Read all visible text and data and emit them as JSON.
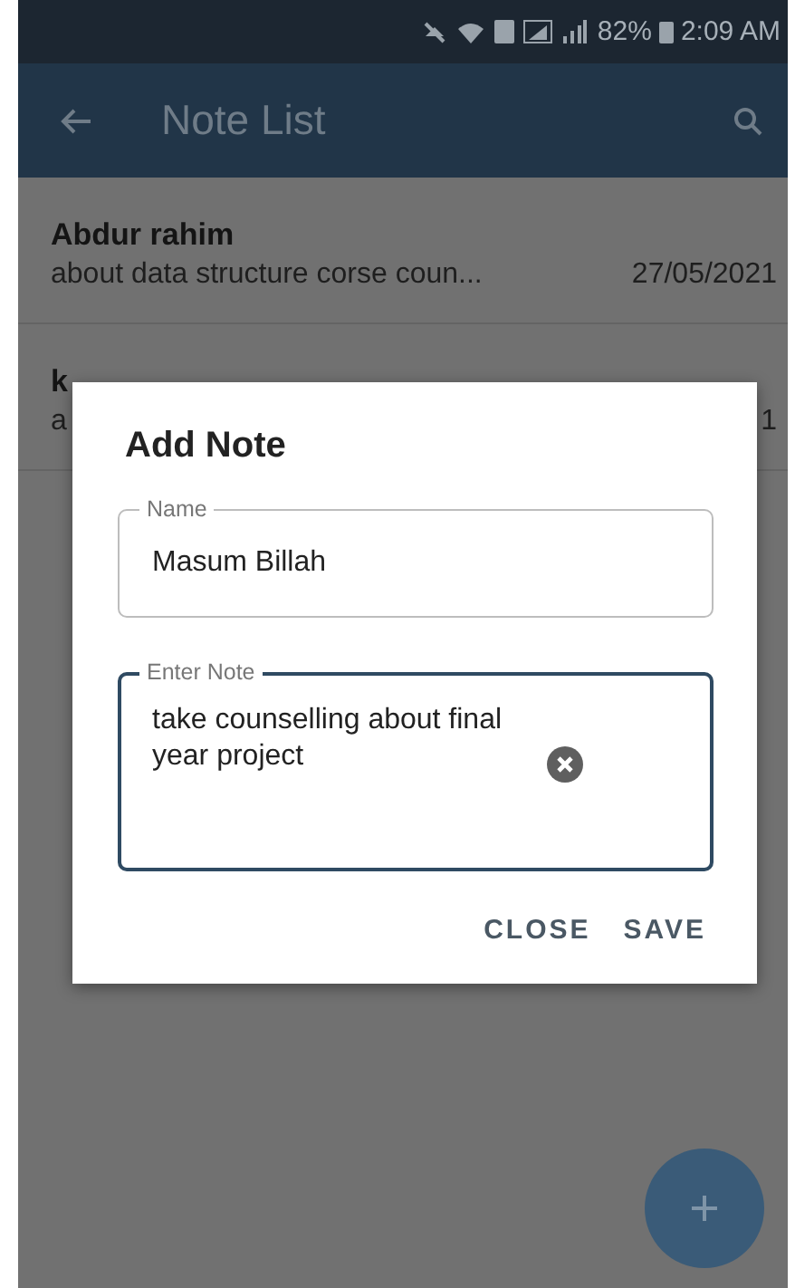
{
  "status_bar": {
    "battery": "82%",
    "time": "2:09 AM"
  },
  "app_bar": {
    "title": "Note List"
  },
  "notes": [
    {
      "name": "Abdur rahim",
      "note": "about data structure corse coun...",
      "date": "27/05/2021"
    },
    {
      "name": "k",
      "note": "a",
      "date": "1"
    }
  ],
  "dialog": {
    "title": "Add Note",
    "fields": [
      {
        "label": "Name",
        "value": "Masum Billah",
        "focused": false,
        "clear_button": false
      },
      {
        "label": "Enter Note",
        "value": "take counselling about final year project",
        "focused": true,
        "clear_button": true
      }
    ],
    "buttons": [
      "CLOSE",
      "SAVE"
    ]
  }
}
